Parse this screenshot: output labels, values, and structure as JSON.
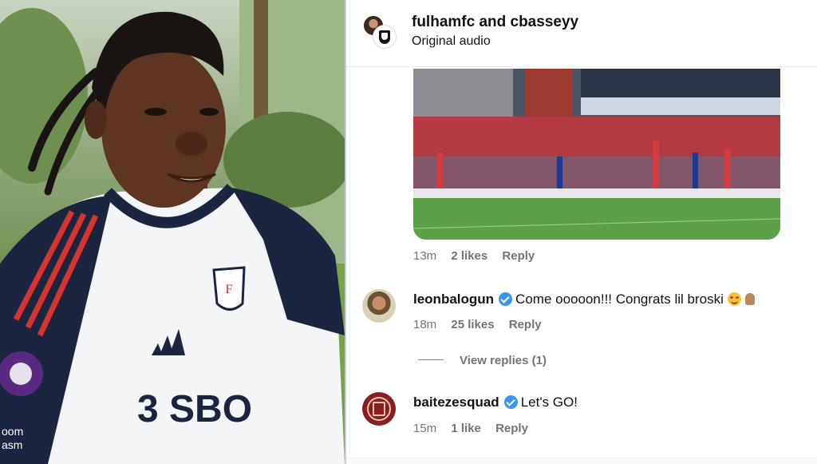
{
  "header": {
    "title": "fulhamfc and cbasseyy",
    "subtitle": "Original audio"
  },
  "video_comment": {
    "time": "13m",
    "likes": "2 likes",
    "reply": "Reply"
  },
  "comments": [
    {
      "username": "leonbalogun",
      "verified": true,
      "text": "Come ooooon!!! Congrats lil broski",
      "emojis": [
        "star-struck-emoji",
        "folded-hands-emoji"
      ],
      "time": "18m",
      "likes": "25 likes",
      "reply": "Reply",
      "view_replies": "View replies (1)"
    },
    {
      "username": "baitezesquad",
      "verified": true,
      "text": "Let's GO!",
      "time": "15m",
      "likes": "1 like",
      "reply": "Reply"
    }
  ],
  "photo": {
    "shirt_sponsor": "SBOTOP",
    "badge_text": "oom\nasm"
  },
  "colors": {
    "verified": "#3897f0",
    "meta_text": "#737373",
    "kit_navy": "#1b2540",
    "kit_red": "#d8342f"
  }
}
